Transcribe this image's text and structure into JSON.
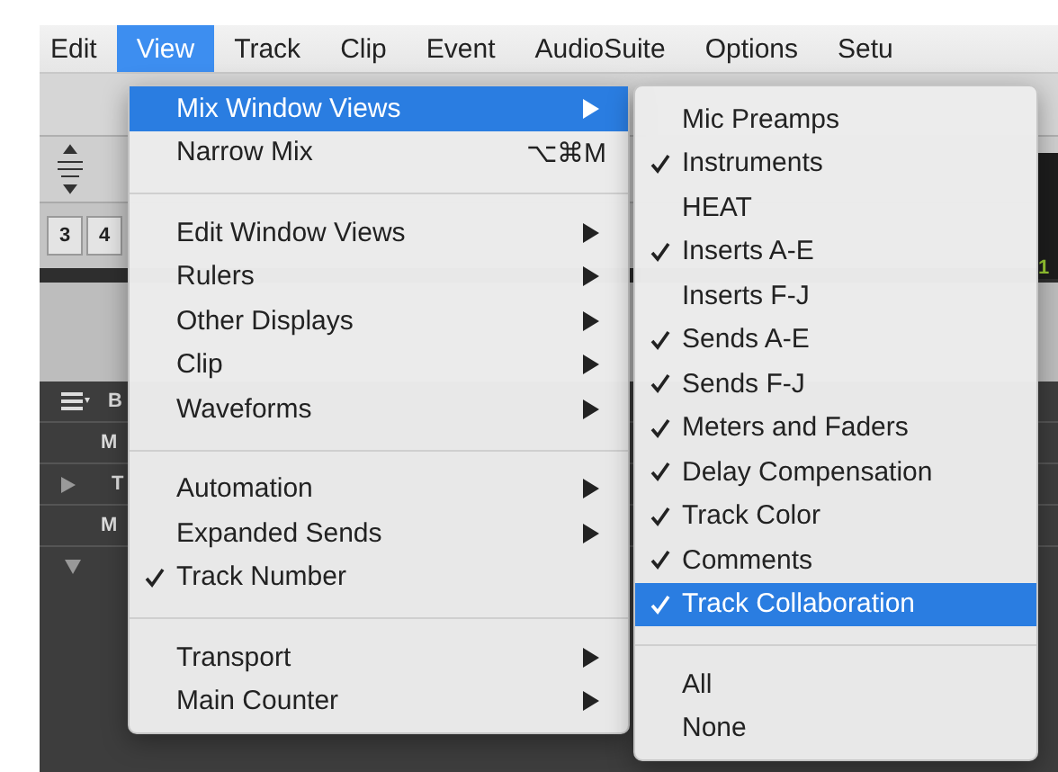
{
  "menu_bar": [
    {
      "label": "Edit",
      "selected": false
    },
    {
      "label": "View",
      "selected": true
    },
    {
      "label": "Track",
      "selected": false
    },
    {
      "label": "Clip",
      "selected": false
    },
    {
      "label": "Event",
      "selected": false
    },
    {
      "label": "AudioSuite",
      "selected": false
    },
    {
      "label": "Options",
      "selected": false
    },
    {
      "label": "Setu",
      "selected": false
    }
  ],
  "view_menu": {
    "items": [
      {
        "kind": "item",
        "label": "Mix Window Views",
        "checked": false,
        "selected": true,
        "has_submenu": true
      },
      {
        "kind": "item",
        "label": "Narrow Mix",
        "checked": false,
        "selected": false,
        "has_submenu": false,
        "shortcut": "⌥⌘M"
      },
      {
        "kind": "separator"
      },
      {
        "kind": "item",
        "label": "Edit Window Views",
        "checked": false,
        "selected": false,
        "has_submenu": true
      },
      {
        "kind": "item",
        "label": "Rulers",
        "checked": false,
        "selected": false,
        "has_submenu": true
      },
      {
        "kind": "item",
        "label": "Other Displays",
        "checked": false,
        "selected": false,
        "has_submenu": true
      },
      {
        "kind": "item",
        "label": "Clip",
        "checked": false,
        "selected": false,
        "has_submenu": true
      },
      {
        "kind": "item",
        "label": "Waveforms",
        "checked": false,
        "selected": false,
        "has_submenu": true
      },
      {
        "kind": "separator"
      },
      {
        "kind": "item",
        "label": "Automation",
        "checked": false,
        "selected": false,
        "has_submenu": true
      },
      {
        "kind": "item",
        "label": "Expanded Sends",
        "checked": false,
        "selected": false,
        "has_submenu": true
      },
      {
        "kind": "item",
        "label": "Track Number",
        "checked": true,
        "selected": false,
        "has_submenu": false
      },
      {
        "kind": "separator"
      },
      {
        "kind": "item",
        "label": "Transport",
        "checked": false,
        "selected": false,
        "has_submenu": true
      },
      {
        "kind": "item",
        "label": "Main Counter",
        "checked": false,
        "selected": false,
        "has_submenu": true
      }
    ]
  },
  "mix_window_views_submenu": {
    "items": [
      {
        "kind": "item",
        "label": "Mic Preamps",
        "checked": false,
        "selected": false
      },
      {
        "kind": "item",
        "label": "Instruments",
        "checked": true,
        "selected": false
      },
      {
        "kind": "item",
        "label": "HEAT",
        "checked": false,
        "selected": false
      },
      {
        "kind": "item",
        "label": "Inserts A-E",
        "checked": true,
        "selected": false
      },
      {
        "kind": "item",
        "label": "Inserts F-J",
        "checked": false,
        "selected": false
      },
      {
        "kind": "item",
        "label": "Sends A-E",
        "checked": true,
        "selected": false
      },
      {
        "kind": "item",
        "label": "Sends F-J",
        "checked": true,
        "selected": false
      },
      {
        "kind": "item",
        "label": "Meters and Faders",
        "checked": true,
        "selected": false
      },
      {
        "kind": "item",
        "label": "Delay Compensation",
        "checked": true,
        "selected": false
      },
      {
        "kind": "item",
        "label": "Track Color",
        "checked": true,
        "selected": false
      },
      {
        "kind": "item",
        "label": "Comments",
        "checked": true,
        "selected": false
      },
      {
        "kind": "item",
        "label": "Track Collaboration",
        "checked": true,
        "selected": true
      },
      {
        "kind": "separator"
      },
      {
        "kind": "item",
        "label": "All",
        "checked": false,
        "selected": false
      },
      {
        "kind": "item",
        "label": "None",
        "checked": false,
        "selected": false
      }
    ]
  },
  "background_window": {
    "ruler_numbers": [
      "3",
      "4"
    ],
    "track_rows": [
      "B",
      "M",
      "T",
      "M"
    ],
    "meter_label": "1"
  }
}
